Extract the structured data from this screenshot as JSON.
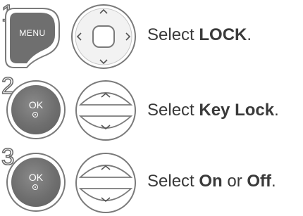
{
  "steps": [
    {
      "number": "1",
      "button_label": "MENU",
      "control": "navigation-pad",
      "text_prefix": "Select ",
      "text_bold": "LOCK",
      "text_suffix": "."
    },
    {
      "number": "2",
      "button_label": "OK",
      "control": "up-down-buttons",
      "text_prefix": "Select ",
      "text_bold": "Key Lock",
      "text_suffix": "."
    },
    {
      "number": "3",
      "button_label": "OK",
      "control": "up-down-buttons",
      "text_prefix": "Select ",
      "text_bold": "On",
      "text_middle": " or ",
      "text_bold_2": "Off",
      "text_suffix": "."
    }
  ]
}
